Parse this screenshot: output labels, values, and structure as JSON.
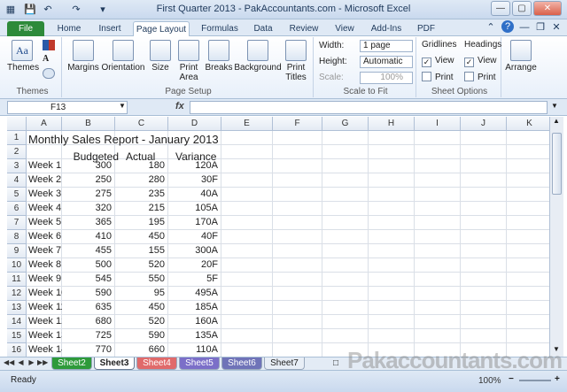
{
  "window": {
    "title": "First Quarter 2013 - PakAccountants.com - Microsoft Excel"
  },
  "ribbon_tabs": [
    "File",
    "Home",
    "Insert",
    "Page Layout",
    "Formulas",
    "Data",
    "Review",
    "View",
    "Add-Ins",
    "PDF"
  ],
  "active_tab": "Page Layout",
  "ribbon": {
    "themes": {
      "button": "Themes",
      "group": "Themes",
      "big_letters": "Aa"
    },
    "page_setup": {
      "group": "Page Setup",
      "buttons": [
        "Margins",
        "Orientation",
        "Size",
        "Print Area",
        "Breaks",
        "Background",
        "Print Titles"
      ]
    },
    "scale_to_fit": {
      "group": "Scale to Fit",
      "width_label": "Width:",
      "width_value": "1 page",
      "height_label": "Height:",
      "height_value": "Automatic",
      "scale_label": "Scale:",
      "scale_value": "100%"
    },
    "sheet_options": {
      "group": "Sheet Options",
      "gridlines": "Gridlines",
      "headings": "Headings",
      "view": "View",
      "print": "Print"
    },
    "arrange": {
      "button": "Arrange"
    }
  },
  "formula_bar": {
    "name_box": "F13",
    "fx": "fx",
    "formula": ""
  },
  "columns": [
    "A",
    "B",
    "C",
    "D",
    "E",
    "F",
    "G",
    "H",
    "I",
    "J",
    "K"
  ],
  "rows": [
    "1",
    "2",
    "3",
    "4",
    "5",
    "6",
    "7",
    "8",
    "9",
    "10",
    "11",
    "12",
    "13",
    "14",
    "15",
    "16"
  ],
  "sheet": {
    "title": "Monthly Sales Report - January 2013",
    "headers": [
      "Budgeted",
      "Actual",
      "Variance"
    ],
    "data": [
      [
        "Week 1",
        "300",
        "180",
        "120A"
      ],
      [
        "Week 2",
        "250",
        "280",
        "30F"
      ],
      [
        "Week 3",
        "275",
        "235",
        "40A"
      ],
      [
        "Week 4",
        "320",
        "215",
        "105A"
      ],
      [
        "Week 5",
        "365",
        "195",
        "170A"
      ],
      [
        "Week 6",
        "410",
        "450",
        "40F"
      ],
      [
        "Week 7",
        "455",
        "155",
        "300A"
      ],
      [
        "Week 8",
        "500",
        "520",
        "20F"
      ],
      [
        "Week 9",
        "545",
        "550",
        "5F"
      ],
      [
        "Week 10",
        "590",
        "95",
        "495A"
      ],
      [
        "Week 11",
        "635",
        "450",
        "185A"
      ],
      [
        "Week 12",
        "680",
        "520",
        "160A"
      ],
      [
        "Week 13",
        "725",
        "590",
        "135A"
      ],
      [
        "Week 14",
        "770",
        "660",
        "110A"
      ]
    ]
  },
  "sheet_tabs": [
    {
      "name": "Sheet2",
      "color": "#2e9a3a",
      "active": false
    },
    {
      "name": "Sheet3",
      "color": "#ffffff",
      "active": true
    },
    {
      "name": "Sheet4",
      "color": "#e06a6a",
      "active": false
    },
    {
      "name": "Sheet5",
      "color": "#7b6fc8",
      "active": false
    },
    {
      "name": "Sheet6",
      "color": "#6f73b8",
      "active": false
    },
    {
      "name": "Sheet7",
      "color": "#e8eef6",
      "active": false
    }
  ],
  "status": {
    "text": "Ready",
    "zoom": "100%"
  },
  "watermark": "Pakaccountants.com"
}
